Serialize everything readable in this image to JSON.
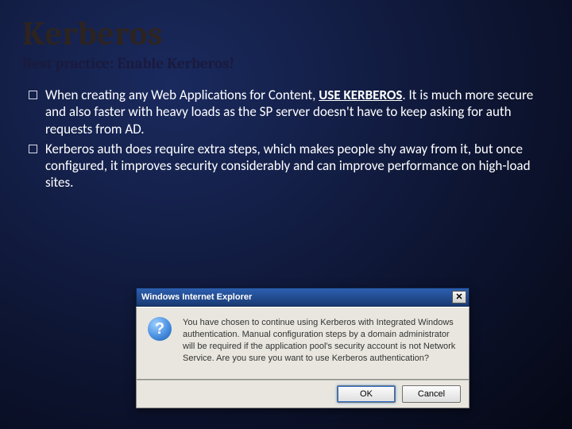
{
  "slide": {
    "title": "Kerberos",
    "subtitle": "Best practice: Enable Kerberos!",
    "bullets": [
      {
        "pre": "When creating any Web Applications for Content, ",
        "emph": "USE KERBEROS",
        "post": ".  It is much more secure and also faster with heavy loads as the SP server doesn't have to keep asking for auth requests from AD."
      },
      {
        "pre": "Kerberos auth does require extra steps, which makes people shy away from it, but once configured, it improves security considerably and can improve performance on high-load sites.",
        "emph": "",
        "post": ""
      }
    ]
  },
  "dialog": {
    "title": "Windows Internet Explorer",
    "close_glyph": "✕",
    "message": "You have chosen to continue using Kerberos with Integrated Windows authentication. Manual configuration steps by a domain administrator will be required if the application pool's security account is not Network Service. Are you sure you want to use Kerberos authentication?",
    "ok_label": "OK",
    "cancel_label": "Cancel"
  }
}
